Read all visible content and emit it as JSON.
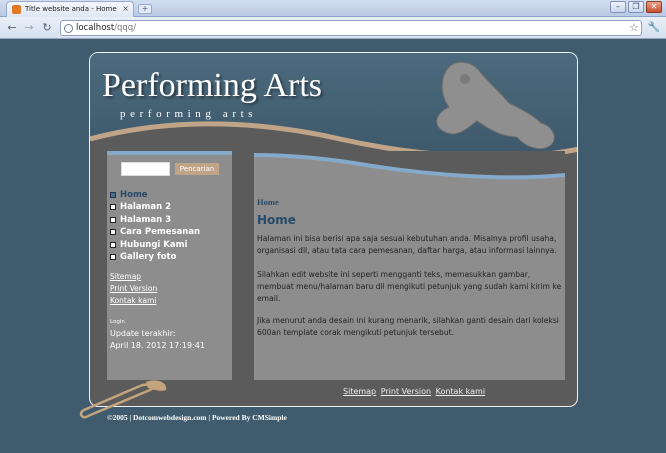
{
  "browser": {
    "tab_title": "Title website anda - Home",
    "url_host": "localhost",
    "url_path": "/qqq/"
  },
  "site": {
    "brand": "Performing Arts",
    "tagline": "performing arts"
  },
  "search": {
    "value": "",
    "button_label": "Pencarian"
  },
  "menu": [
    {
      "label": "Home",
      "active": true
    },
    {
      "label": "Halaman 2",
      "active": false
    },
    {
      "label": "Halaman 3",
      "active": false
    },
    {
      "label": "Cara Pemesanan",
      "active": false
    },
    {
      "label": "Hubungi Kami",
      "active": false
    },
    {
      "label": "Gallery foto",
      "active": false
    }
  ],
  "side_links": [
    "Sitemap",
    "Print Version",
    "Kontak kami"
  ],
  "login_label": "Login",
  "update_label": "Update terakhir:",
  "update_value": "April 18. 2012 17:19:41",
  "content": {
    "breadcrumb": "Home",
    "title": "Home",
    "paragraphs": [
      "Halaman ini bisa berisi apa saja sesuai kebutuhan anda. Misalnya profil usaha, organisasi dll, atau tata cara pemesanan, daftar harga, atau informasi lainnya.",
      "Silahkan edit website ini seperti mengganti teks, memasukkan gambar, membuat menu/halaman baru dll mengikuti petunjuk yang sudah kami kirim ke email.",
      "Jika menurut anda desain ini kurang menarik, silahkan ganti desain dari koleksi 600an template corak mengikuti petunjuk tersebut."
    ]
  },
  "footer_links": [
    "Sitemap",
    "Print Version",
    "Kontak kami"
  ],
  "copyright": "©2005  |  Dotcomwebdesign.com  |  Powered By CMSimple",
  "colors": {
    "page_bg": "#3f5b6d",
    "panel": "#8d8d8d",
    "accent_tan": "#bfa488",
    "accent_blue": "#84a9cb",
    "heading": "#284a68"
  }
}
